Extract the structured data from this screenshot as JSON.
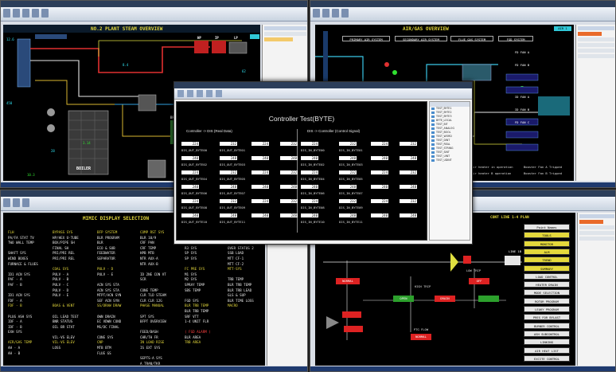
{
  "q1": {
    "header": "NO.2 PLANT STEAM OVERVIEW",
    "tag_boiler": "BOILER",
    "tag_condenser": "CONDENSER",
    "tag_bfp": "BFP",
    "tag_hp": "HP",
    "tag_ip": "IP",
    "tag_lp": "LP"
  },
  "q2": {
    "header": "AIR/GAS OVERVIEW",
    "tag_air": "AIR 1",
    "systems": [
      "PRIMARY AIR SYSTEM",
      "SECONDARY AIR SYSTEM",
      "FLUE GAS SYSTEM",
      "FGD SYSTEM"
    ],
    "fans": [
      "FD FAN A",
      "FD FAN B",
      "ID FAN A",
      "ID FAN B",
      "FD FAN C"
    ],
    "booster_fan": "Booster Fan A Tripped",
    "booster_fan_b": "Booster Fan B Tripped",
    "air_heater": "Air heater in operation",
    "air_heater_b": "Air heater B operation"
  },
  "q3": {
    "header": "MIMIC DISPLAY SELECTION",
    "columns": [
      [
        "FLH",
        "PA/FA STAT TV",
        "TWO WALL TEMP",
        "",
        "SHAFT SYS",
        "WIND BOXES",
        "FURNACE & FLUES",
        "",
        "ID1 ACN SYS",
        "PAF - A",
        "PAF - B",
        "",
        "ID1 ACN SYS",
        "FDF - A",
        "FDF - B",
        "",
        "PLUG ASH SYS",
        "IDF - A",
        "IDF - B",
        "EXH SYS",
        "",
        "AIR/GAS TEMP",
        "AH - A",
        "AH - B"
      ],
      [
        "BYPASS SYS",
        "HP/HEX U-TUBE",
        "BOX/PIPE SH",
        "FINAL SH",
        "PRI/PRI REL",
        "PRI/PRI REL",
        "",
        "COAL SYS",
        "PULV - A",
        "PULV - B",
        "PULV - C",
        "PULV - D",
        "PULV - E",
        "",
        "BOAS & VENT",
        "",
        "OIL LEAD TEST",
        "BNR STATUS",
        "OIL BR STAT",
        "",
        "VIL-VS ELEV",
        "VIL-VS ELEV",
        "LOSS"
      ],
      [
        "BFP SYSTEM",
        "BLR PROGRAM",
        "BLR",
        "ECO & SUB",
        "FEEDWATER",
        "SEPARATOR",
        "",
        "PULV - D",
        "PULV - E",
        "",
        "ACN SYS STA",
        "ACN SYS STA",
        "MTPT/ACN SYN",
        "SEF ACN SYN",
        "SS/DRAW DRAW",
        "",
        "OWN DRAIN",
        "EC VDWN COND",
        "MS/DC FINAL",
        "",
        "CONE SYS",
        "CNP",
        "MTB BTM",
        "FLUE GS"
      ],
      [
        "COMP RST SYS",
        "BLR 10/9",
        "CRF PAN",
        "CRF TEMP",
        "HPB MTB",
        "NTR AUX-A",
        "NTR AUX-B",
        "",
        "ID 2NE CON VT",
        "SCR",
        "",
        "CONE TEMP",
        "CLR TLD STEAM",
        "CLR CLR 12G",
        "PHASE MANUAL",
        "",
        "SPT SYS",
        "BFPT OVERVIEW",
        "",
        "FEED/BASH",
        "CHR/TH FR",
        "IN LOAD RISE",
        "IS EXT SYS",
        "",
        "SEPTS-A SYS",
        "A TRAN/TKR",
        "A CCL SYS"
      ],
      [
        "FG PRE SYS",
        "R1 SYS",
        "R2 SYS",
        "R3 SYS",
        "SP SYS",
        "SP SYS",
        "",
        "FC PRE SYS",
        "M1 SYS",
        "M2 SYS",
        "SPRAY TEMP",
        "SBS TEMP",
        "",
        "FGD SYS",
        "BLR TRB TEMP",
        "BLR TRB TEMP",
        "SRF VTT",
        "1-4 UNIT FLR",
        "",
        "( FGD ALARM )",
        "BLR AREA",
        "TRB AREA"
      ],
      [
        "AAP START",
        "PLANT OVERVIEW",
        "OVER STATUS 1",
        "OVER STATUS 2",
        "SSB LOAD",
        "MTT CF-1",
        "MTT CF-2",
        "MTT-SYS",
        "",
        "TRB TEMP",
        "BLR TRB TEMP",
        "BLR TRB LEAD",
        "GLS & SUP",
        "BLR TIME LOSS",
        "MACRO"
      ]
    ]
  },
  "q4": {
    "header": "CONT LINE 1-4 PLAN",
    "menu": [
      "Point Names",
      "TOOLS",
      "MONITOR",
      "ALM",
      "TREND",
      "SUMMARY",
      "LOAD CONTROL",
      "HEATER DRAIN",
      "MODE SELECTION",
      "ROTOR PROGRAM",
      "LEAKY PROGRAM",
      "PRES FOR BYLAST",
      "BURNER CONTROL",
      "ASH SUBCONTROL",
      "LINKING",
      "AIR HEAT LIST",
      "EXCITE CONTROL"
    ],
    "labels": [
      "LINE 1B",
      "NORMAL",
      "OFF",
      "OPEN",
      "DRAIN",
      "HIGH TRIP",
      "LOW TRIP",
      "PTG FLOW",
      "NORMAL"
    ]
  },
  "dialog": {
    "title": "Controller Test(BYTE)",
    "left_sub": "Controller -> DIS (Real Data)",
    "right_sub": "DIS -> Controller (Control Signal)",
    "left_rows": [
      {
        "label1": "DIS_OUT_BYTE00",
        "v1": "224",
        "label2": "DIS_OUT_BYTE01",
        "v2": "232"
      },
      {
        "label1": "DIS_OUT_BYTE02",
        "v1": "240",
        "label2": "DIS_OUT_BYTE03",
        "v2": "248"
      },
      {
        "label1": "DIS_OUT_BYTE04",
        "v1": "224",
        "label2": "DIS_OUT_BYTE05",
        "v2": "232"
      },
      {
        "label1": "DIS_OUT_BYTE06",
        "v1": "240",
        "label2": "DIS_OUT_BYTE07",
        "v2": "248"
      },
      {
        "label1": "DIS_OUT_BYTE08",
        "v1": "224",
        "label2": "DIS_OUT_BYTE09",
        "v2": "232"
      },
      {
        "label1": "DIS_OUT_BYTE10",
        "v1": "240",
        "label2": "DIS_OUT_BYTE11",
        "v2": "248"
      }
    ],
    "right_rows": [
      {
        "label1": "DIS_IN_BYTE00",
        "v1": "224",
        "label2": "DIS_IN_BYTE01",
        "v2": "232"
      },
      {
        "label1": "DIS_IN_BYTE02",
        "v1": "240",
        "label2": "DIS_IN_BYTE03",
        "v2": "248"
      },
      {
        "label1": "DIS_IN_BYTE04",
        "v1": "224",
        "label2": "DIS_IN_BYTE05",
        "v2": "232"
      },
      {
        "label1": "DIS_IN_BYTE06",
        "v1": "240",
        "label2": "DIS_IN_BYTE07",
        "v2": "248"
      },
      {
        "label1": "DIS_IN_BYTE08",
        "v1": "224",
        "label2": "DIS_IN_BYTE09",
        "v2": "232"
      },
      {
        "label1": "DIS_IN_BYTE10",
        "v1": "240",
        "label2": "DIS_IN_BYTE11",
        "v2": "248"
      }
    ],
    "side_items": [
      "TEST_BYTE1",
      "TEST_BYTE2",
      "TEST_BYTE3",
      "BYTE_LOCAL",
      "TEST_BIT",
      "TEST_ANALOG",
      "TEST_BOOL",
      "TEST_WORD",
      "TEST_DINT",
      "TEST_REAL",
      "TEST_STRING",
      "TEST_SINT",
      "TEST_UINT",
      "TEST_UDINT"
    ]
  },
  "colors": {
    "yellow": "#e4d83c",
    "cyan": "#33c8d8",
    "red": "#d22",
    "green": "#34c759"
  }
}
